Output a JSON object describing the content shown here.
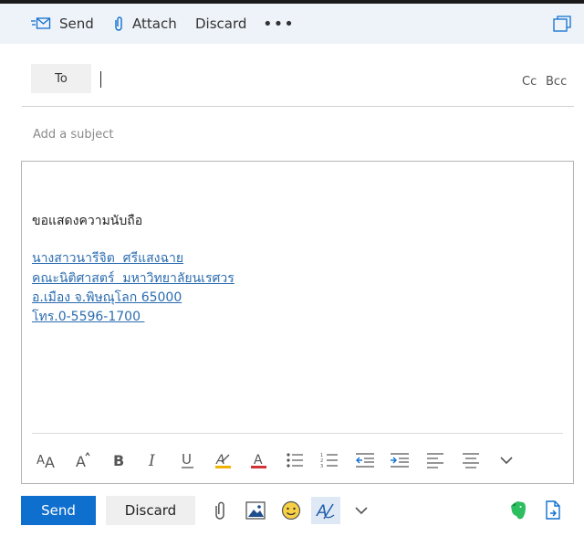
{
  "commandbar": {
    "send": "Send",
    "attach": "Attach",
    "discard": "Discard",
    "more": "•••"
  },
  "recipients": {
    "to_label": "To",
    "cc": "Cc",
    "bcc": "Bcc"
  },
  "subject": {
    "placeholder": "Add a subject"
  },
  "message": {
    "greeting": "ขอแสดงความนับถือ",
    "signature": [
      "นางสาวนารีจิต  ศรีแสงฉาย",
      "คณะนิติศาสตร์  มหาวิทยาลัยนเรศวร",
      "อ.เมือง จ.พิษณุโลก 65000",
      "โทร.0-5596-1700 "
    ]
  },
  "actions": {
    "send": "Send",
    "discard": "Discard"
  },
  "colors": {
    "accent": "#0f6fcf",
    "link": "#2b6cb0",
    "highlight": "#f0b400",
    "font_color": "#d13438",
    "evernote": "#2dbe60"
  }
}
